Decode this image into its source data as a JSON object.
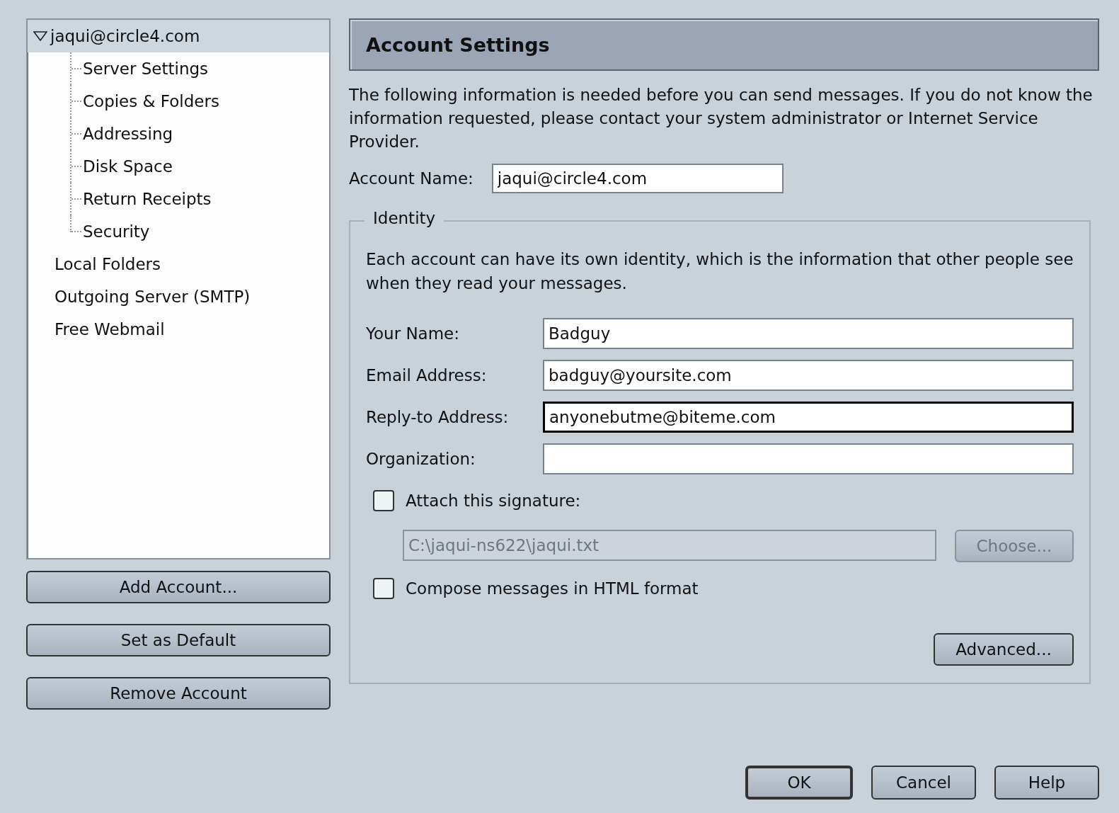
{
  "sidebar": {
    "tree": [
      {
        "label": "jaqui@circle4.com",
        "selected": true,
        "expanded": true,
        "children": [
          {
            "label": "Server Settings",
            "selected": false
          },
          {
            "label": "Copies & Folders",
            "selected": false
          },
          {
            "label": "Addressing",
            "selected": false
          },
          {
            "label": "Disk Space",
            "selected": false
          },
          {
            "label": "Return Receipts",
            "selected": false
          },
          {
            "label": "Security",
            "selected": false
          }
        ]
      },
      {
        "label": "Local Folders",
        "selected": false
      },
      {
        "label": "Outgoing Server (SMTP)",
        "selected": false
      },
      {
        "label": "Free Webmail",
        "selected": false
      }
    ],
    "buttons": [
      "Add Account...",
      "Set as Default",
      "Remove Account"
    ]
  },
  "panel": {
    "title": "Account Settings",
    "intro": "The following information is needed before you can send messages. If you do not know the information requested, please contact your system administrator or Internet Service Provider.",
    "account_name": {
      "label": "Account Name:",
      "value": "jaqui@circle4.com"
    },
    "identity": {
      "legend": "Identity",
      "description": "Each account can have its own identity, which is the information that other people see when they read your messages.",
      "fields": [
        {
          "label": "Your Name:",
          "value": "Badguy",
          "focused": false
        },
        {
          "label": "Email Address:",
          "value": "badguy@yoursite.com",
          "focused": false
        },
        {
          "label": "Reply-to Address:",
          "value": "anyonebutme@biteme.com",
          "focused": true
        },
        {
          "label": "Organization:",
          "focused": false
        }
      ],
      "signature": {
        "label": "Attach this signature:",
        "checked": false,
        "path": "C:\\jaqui-ns622\\jaqui.txt",
        "path_disabled": true,
        "choose": "Choose...",
        "choose_disabled": true
      },
      "html": {
        "label": "Compose messages in HTML format",
        "checked": false
      },
      "advanced": "Advanced..."
    }
  },
  "dialog_buttons": [
    {
      "label": "OK",
      "default": true
    },
    {
      "label": "Cancel",
      "default": false
    },
    {
      "label": "Help",
      "default": false
    }
  ]
}
